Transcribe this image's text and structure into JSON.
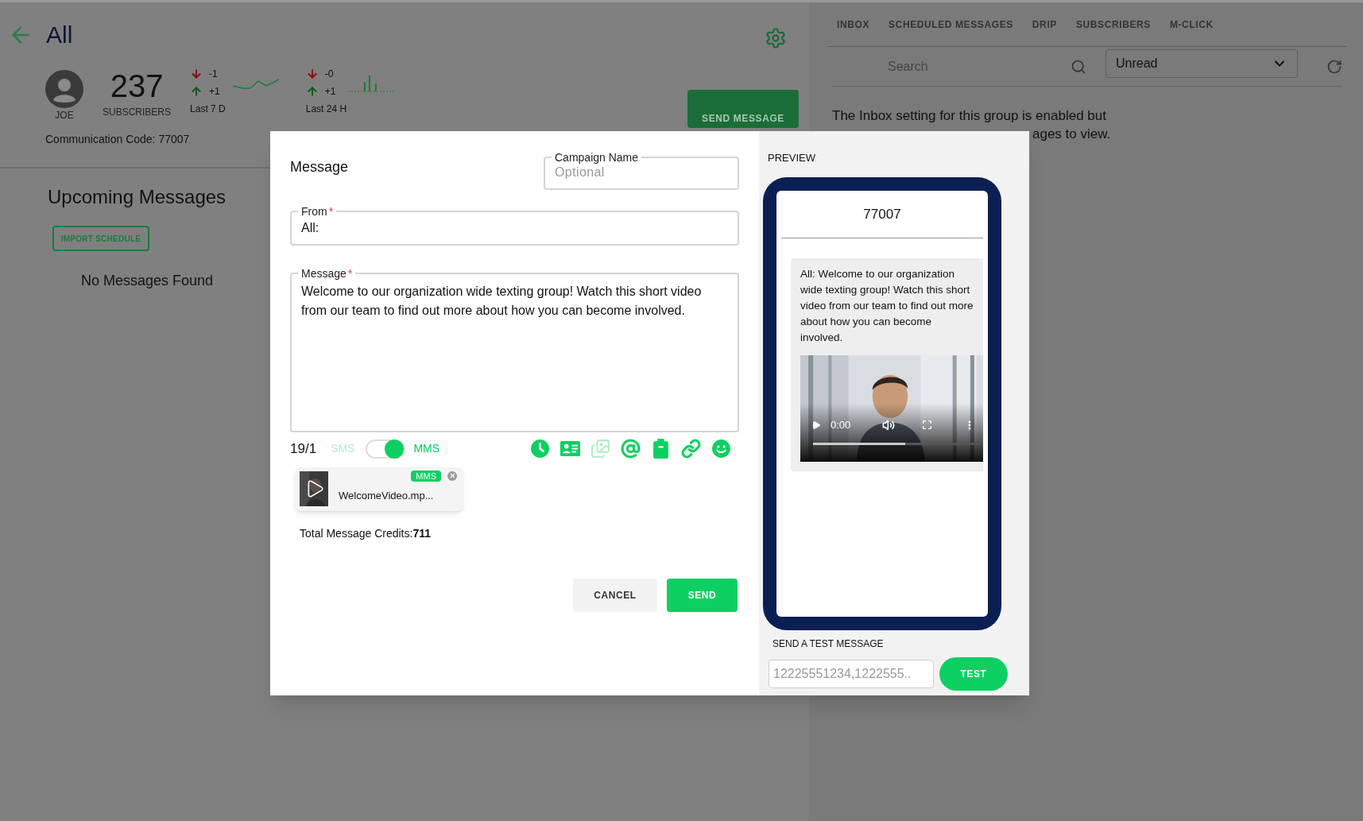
{
  "header": {
    "title": "All"
  },
  "profile": {
    "name": "JOE",
    "count": "237",
    "count_label": "SUBSCRIBERS"
  },
  "trends": [
    {
      "kind": "line",
      "down": "-1",
      "up": "+1",
      "period": "Last 7 D"
    },
    {
      "kind": "bars",
      "down": "-0",
      "up": "+1",
      "period": "Last 24 H"
    }
  ],
  "send_message_button": "SEND MESSAGE",
  "communication_code": "Communication Code: 77007",
  "upcoming": {
    "title": "Upcoming Messages",
    "import_button": "IMPORT SCHEDULE",
    "empty": "No Messages Found"
  },
  "tabs": [
    {
      "label": "INBOX",
      "selected": false
    },
    {
      "label": "SCHEDULED MESSAGES",
      "selected": false
    },
    {
      "label": "DRIP",
      "selected": false
    },
    {
      "label": "SUBSCRIBERS",
      "selected": false
    },
    {
      "label": "M-CLICK",
      "selected": false
    }
  ],
  "search": {
    "placeholder": "Search"
  },
  "filter": {
    "value": "Unread"
  },
  "inbox_notice": "The Inbox setting for this group is enabled but",
  "inbox_notice_tail": "ages to view.",
  "modal": {
    "title": "Message",
    "campaign_name": {
      "label": "Campaign Name",
      "placeholder": "Optional"
    },
    "from": {
      "label": "From",
      "required_mark": "*",
      "value": "All:"
    },
    "message": {
      "label": "Message",
      "required_mark": "*",
      "value": "Welcome to our organization wide texting group! Watch this short video from our team to find out more about how you can become involved."
    },
    "counter": "19/1",
    "mode": {
      "left": "SMS",
      "right": "MMS",
      "on": true
    },
    "tools": [
      {
        "disabled": false
      },
      {
        "disabled": false
      },
      {
        "disabled": true
      },
      {
        "disabled": false
      },
      {
        "disabled": false
      },
      {
        "disabled": false
      },
      {
        "disabled": false
      }
    ],
    "attachment": {
      "badge": "MMS",
      "filename": "WelcomeVideo.mp..."
    },
    "credits": "Total Message Credits:**711**",
    "cancel": "CANCEL",
    "send": "SEND"
  },
  "preview": {
    "title": "PREVIEW",
    "number": "77007",
    "bubble": "All: Welcome to our organization wide texting group! Watch this short video from our team to find out more about how you can become involved.",
    "video": {
      "time": "0:00",
      "level": 0.55
    },
    "test_label": "SEND A TEST MESSAGE",
    "test_placeholder": "12225551234,1222555..",
    "test_button": "TEST"
  }
}
